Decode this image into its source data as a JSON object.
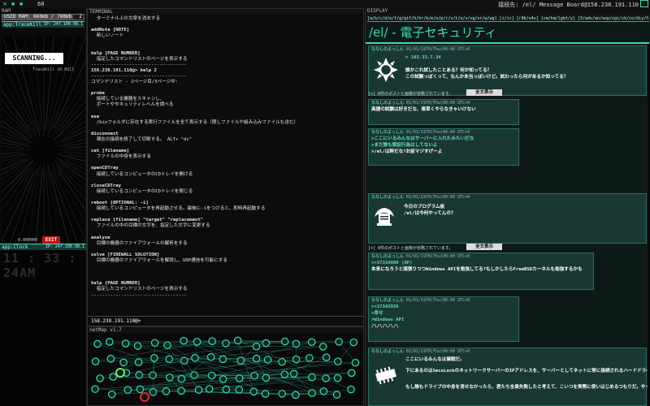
{
  "topbar": {
    "count": "60",
    "connection": "接続先: /el/ Message Board@158.238.191.110"
  },
  "ram": {
    "label": "RAM",
    "used_label": "USED RAM: 660mb / 760mb",
    "used_fraction": 0.87,
    "count": "2",
    "app_name": "app:TraceKill",
    "app_ip": "IP: 247.100.98.1",
    "scanning": "SCANNING...",
    "version": "TraceKill v0.8011",
    "timer": "0.000000",
    "exit": "EXIT"
  },
  "clock": {
    "app_name": "app:Clock",
    "app_ip": "IP: 247.100.98.1",
    "time": "11 : 33 : 24AM"
  },
  "terminal": {
    "label": "TERMINAL",
    "lines": [
      {
        "t": "  ターミナル上の文章を消去する",
        "b": false
      },
      {
        "t": "",
        "b": false
      },
      {
        "t": "addNote [NOTE]",
        "b": true
      },
      {
        "t": "  新しいノート",
        "b": false
      },
      {
        "t": "",
        "b": false
      },
      {
        "t": "",
        "b": false
      },
      {
        "t": "help [PAGE NUMBER]",
        "b": true
      },
      {
        "t": "  指定したコマンドリストのページを表示する",
        "b": false
      },
      {
        "t": "-----------------------------------",
        "b": false
      },
      {
        "t": "158.238.191.110@> help 2",
        "b": true
      },
      {
        "t": "-----------------------------------",
        "b": false
      },
      {
        "t": "コマンドリスト - 2ページ目/3ページ中:",
        "b": false
      },
      {
        "t": "",
        "b": false
      },
      {
        "t": "probe",
        "b": true
      },
      {
        "t": "  接続している機器をスキャンし、",
        "b": false
      },
      {
        "t": "  ポートやセキュリティレベルを調べる",
        "b": false
      },
      {
        "t": "",
        "b": false
      },
      {
        "t": "exe",
        "b": true
      },
      {
        "t": "  /binフォルダに存在する実行ファイルを全て表示する（隠しファイルや組み込みファイルも含む）",
        "b": false
      },
      {
        "t": "",
        "b": false
      },
      {
        "t": "disconnect",
        "b": true
      },
      {
        "t": "  現在の接続を終了して切断する。 ALT+ \"dc\"",
        "b": false
      },
      {
        "t": "",
        "b": false
      },
      {
        "t": "cat [filename]",
        "b": true
      },
      {
        "t": "  ファイルの中身を表示する",
        "b": false
      },
      {
        "t": "",
        "b": false
      },
      {
        "t": "openCDTray",
        "b": true
      },
      {
        "t": "  接続しているコンピュータのCDトレイを開ける",
        "b": false
      },
      {
        "t": "",
        "b": false
      },
      {
        "t": "closeCDTray",
        "b": true
      },
      {
        "t": "  接続しているコンピュータのCDトレイを閉じる",
        "b": false
      },
      {
        "t": "",
        "b": false
      },
      {
        "t": "reboot [OPTIONAL: -i]",
        "b": true
      },
      {
        "t": "  接続しているコンピュータを再起動させる。最後に-iをつけると、即時再起動する",
        "b": false
      },
      {
        "t": "",
        "b": false
      },
      {
        "t": "replace [filename] \"target\" \"replacement\"",
        "b": true
      },
      {
        "t": "  ファイルの中の目標の文字を、指定した文字に変更する",
        "b": false
      },
      {
        "t": "",
        "b": false
      },
      {
        "t": "analyze",
        "b": true
      },
      {
        "t": "  目標の機器のファイアウォールの解析をする",
        "b": false
      },
      {
        "t": "",
        "b": false
      },
      {
        "t": "solve [FIREWALL SOLUTION]",
        "b": true
      },
      {
        "t": "  目標の機器のファイアウォールを解読し、UDP通信を可能にする",
        "b": false
      },
      {
        "t": "",
        "b": false
      },
      {
        "t": "",
        "b": false
      },
      {
        "t": "",
        "b": false
      },
      {
        "t": "help [PAGE NUMBER]",
        "b": true
      },
      {
        "t": "  指定したコマンドリストのページを表示する",
        "b": false
      },
      {
        "t": "-----------------------------------",
        "b": false
      }
    ],
    "prompt": "158.238.191.110@>"
  },
  "netmap": {
    "label": "netMap v1.7"
  },
  "display": {
    "label": "DISPLAY",
    "nav": "[a/b/c/d/e/f/g/gif/h/hr/k/m/o/p/r/s/t/u/v/vg/vr/w/wg] [i/ic] [r9k/s4s] [cm/hm/lgbt/y] [3/adv/an/asp/cgi/ck/co/diy/fa/fit/gd/hc/his/int/jp/lit/mlp/mu/n/news/out/po/pol/qst/sci/soc/sp/tg/toy/trv/tv/vp/wsg/wsr/x]",
    "title": "/el/ - 電子セキュリティ",
    "threads": [
      {
        "name": "ななしのよっしん",
        "date": "01/01/1970(Thu)00:00 UTC+0",
        "lines": [
          "> 103.31.7.34",
          "",
          "誰かこれ試したことある？何か知ってる？",
          "この試験っぽくって、なんか本当っぽいけど。試わったら何があるか知ってる？"
        ],
        "info": "[+]  8件のポストと画像が省略されています。",
        "showall": "全文表示"
      },
      {
        "name": "ななしのよっしん",
        "date": "01/01/1970(Thu)00:00 UTC+0",
        "lines": [
          "今日のプログラム板",
          "/el/は今何やってんの？"
        ],
        "info": "[+]  8件のポストと画像が省略されています。",
        "showall": "全文表示"
      }
    ],
    "replies": [
      {
        "name": "ななしのよっしん",
        "date": "01/01/1970(Thu)00:00 UTC+0",
        "lines": [
          "高捷の試験は好きだな、楽草くやらなきゃいけない"
        ]
      },
      {
        "name": "ななしのよっしん",
        "date": "01/01/1970(Thu)00:00 UTC+0",
        "lines": [
          ">ここにいるみんなはサーバーに入れたみたいだな",
          ">まだ誰も認証行為はしてないよ",
          ">/el/は幹だな?お前マジすげーよ"
        ]
      },
      {
        "name": "ななしのよっしん",
        "date": "01/01/1970(Thu)00:00 UTC+0",
        "lines": [
          ">>37334068 (OP)",
          "本来になろうと頑張りつつWindows APIを勉強してる?もしかしたらFreeBSDカーネルも勉強するかも"
        ]
      },
      {
        "name": "ななしのよっしん",
        "date": "01/01/1970(Thu)00:00 UTC+0",
        "lines": [
          ">>37343926",
          ">幸せ",
          ">Windows API",
          "/\\/\\/\\/\\/\\"
        ]
      },
      {
        "name": "ななしのよっしん",
        "date": "01/01/1970(Thu)00:00 UTC+0",
        "lines": [
          "ここにいるみんなは健戦だ。",
          "下にあるのはSecuLockのネットワークサーバーのIPアドレスを、サーバーとしてネットに常に接続されるハードドライブにしてる。",
          "もし誰もドライブの中身を消せなかったら、君たち全員失敗したと考えて、こいつを実際に使いはじめるつもりだ。やってくれ。"
        ]
      }
    ]
  }
}
